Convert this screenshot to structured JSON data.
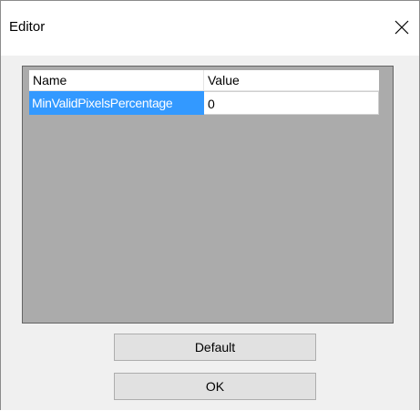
{
  "window": {
    "title": "Editor",
    "close_icon": "close-icon"
  },
  "grid": {
    "columns": [
      "Name",
      "Value"
    ],
    "rows": [
      {
        "name": "MinValidPixelsPercentage",
        "value": "0",
        "selected": true
      }
    ],
    "colors": {
      "selection": "#3399ff",
      "background": "#ababab"
    }
  },
  "buttons": {
    "default_label": "Default",
    "ok_label": "OK"
  }
}
